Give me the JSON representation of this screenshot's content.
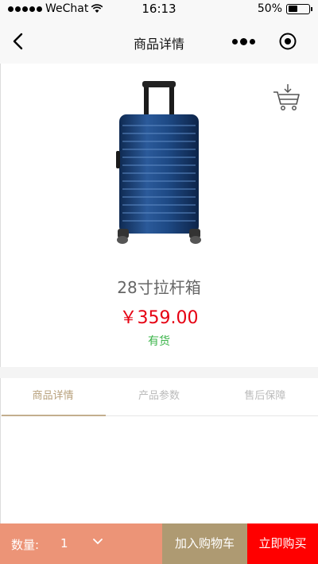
{
  "status_bar": {
    "carrier": "WeChat",
    "time": "16:13",
    "battery_percent": "50%",
    "battery_level": 0.5
  },
  "nav": {
    "title": "商品详情",
    "icons": [
      "back-icon",
      "more-icon",
      "close-circle-icon"
    ]
  },
  "product": {
    "name": "28寸拉杆箱",
    "price": "￥359.00",
    "stock": "有货",
    "image": "suitcase-image",
    "price_color": "#e60012",
    "stock_color": "#3bb44a"
  },
  "tabs": [
    {
      "label": "商品详情",
      "active": true
    },
    {
      "label": "产品参数",
      "active": false
    },
    {
      "label": "售后保障",
      "active": false
    }
  ],
  "bottom_bar": {
    "quantity_label": "数量:",
    "quantity_value": "1",
    "add_to_cart_label": "加入购物车",
    "buy_now_label": "立即购买",
    "colors": {
      "quantity_bg": "#ec9477",
      "cart_bg": "#ae9a72",
      "buy_bg": "#ff0000"
    }
  }
}
